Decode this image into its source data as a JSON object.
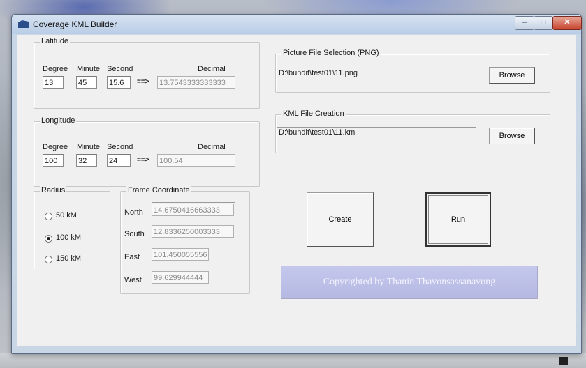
{
  "window": {
    "title": "Coverage KML Builder",
    "controls": {
      "minimize": "–",
      "maximize": "□",
      "close": "✕"
    }
  },
  "latitude": {
    "legend": "Latitude",
    "degree_label": "Degree",
    "minute_label": "Minute",
    "second_label": "Second",
    "decimal_label": "Decimal",
    "degree": "13",
    "minute": "45",
    "second": "15.6",
    "arrow": "==>",
    "decimal": "13.7543333333333"
  },
  "longitude": {
    "legend": "Longitude",
    "degree_label": "Degree",
    "minute_label": "Minute",
    "second_label": "Second",
    "decimal_label": "Decimal",
    "degree": "100",
    "minute": "32",
    "second": "24",
    "arrow": "==>",
    "decimal": "100.54"
  },
  "radius": {
    "legend": "Radius",
    "options": [
      "50 kM",
      "100 kM",
      "150 kM"
    ],
    "selected": "100 kM"
  },
  "frame": {
    "legend": "Frame Coordinate",
    "north_label": "North",
    "south_label": "South",
    "east_label": "East",
    "west_label": "West",
    "north": "14.6750416663333",
    "south": "12.8336250003333",
    "east": "101.450055556",
    "west": "99.629944444"
  },
  "picture": {
    "legend": "Picture File Selection (PNG)",
    "path": "D:\\bundit\\test01\\11.png",
    "browse_label": "Browse"
  },
  "kml": {
    "legend": "KML File Creation",
    "path": "D:\\bundit\\test01\\11.kml",
    "browse_label": "Browse"
  },
  "actions": {
    "create_label": "Create",
    "run_label": "Run"
  },
  "copyright": "Copyrighted by Thanin  Thavonsassanavong",
  "colors": {
    "titlebar": "#c2d3e9",
    "close_button": "#c8452e",
    "copyright_bg": "#c0c3ea"
  }
}
